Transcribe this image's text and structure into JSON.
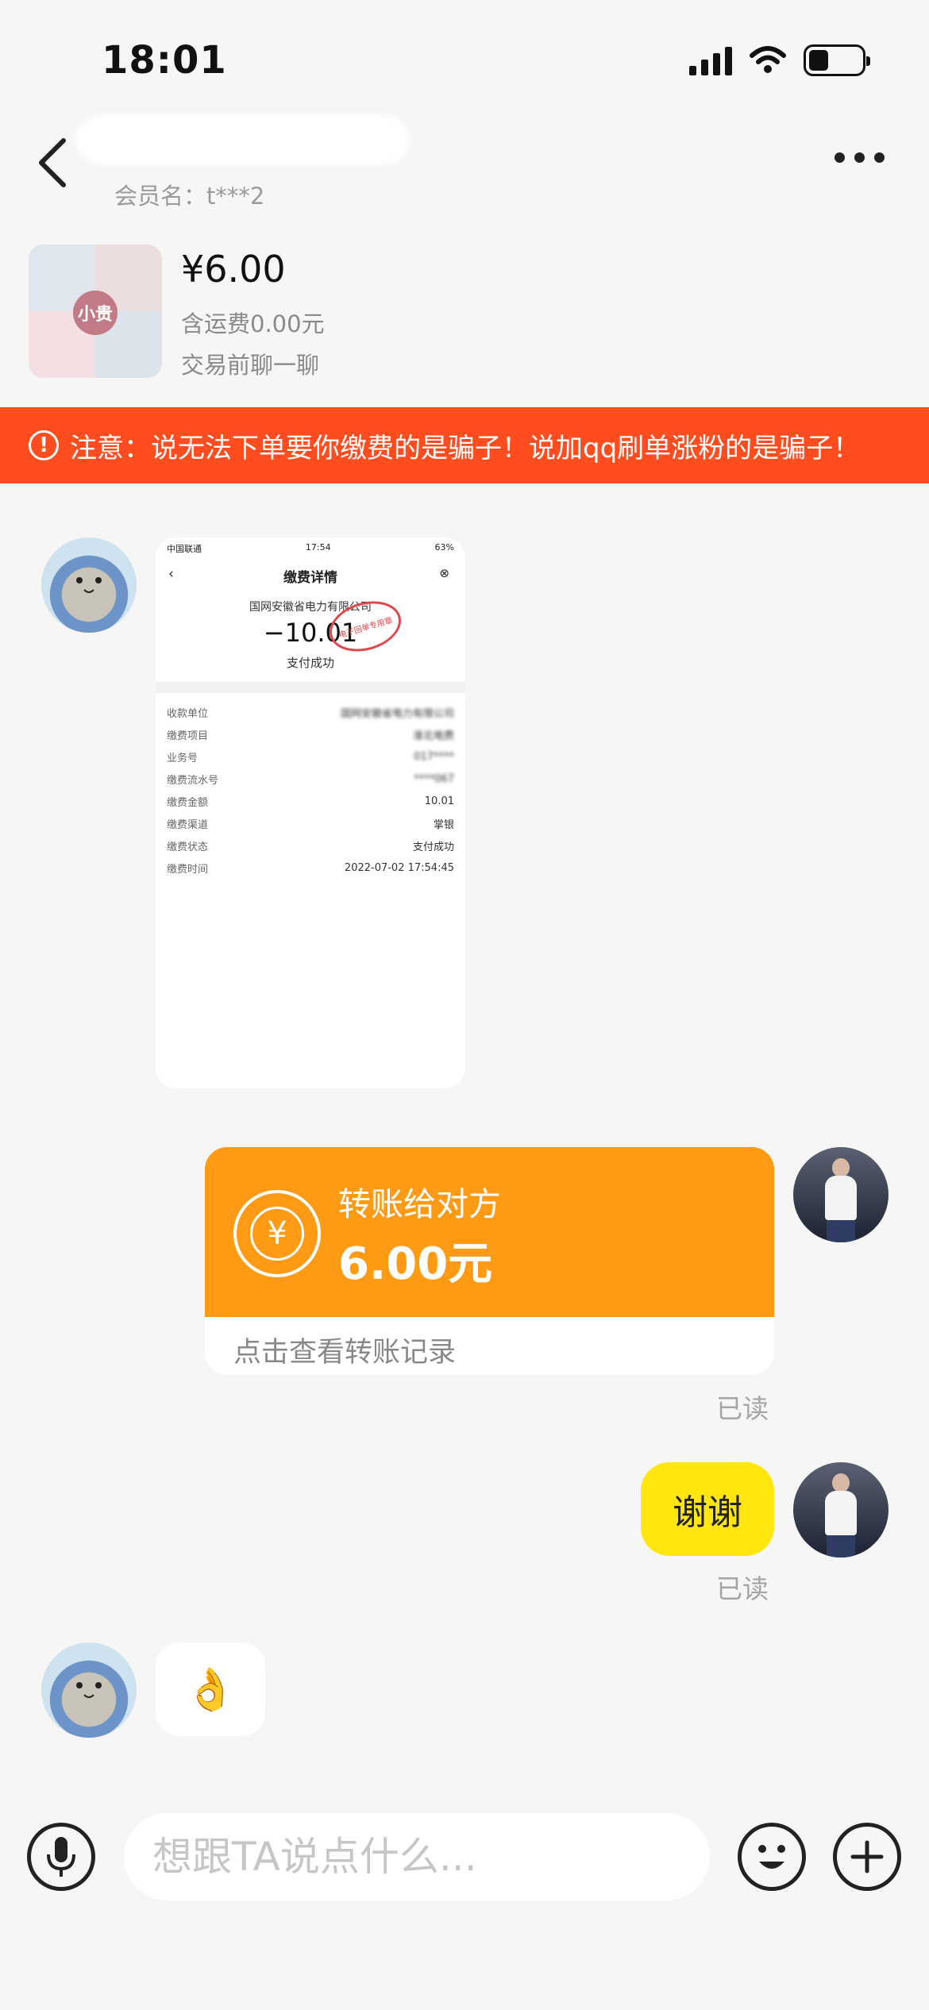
{
  "status_bar": {
    "time": "18:01"
  },
  "header": {
    "member_label": "会员名：t***2"
  },
  "product": {
    "price": "¥6.00",
    "shipping": "含运费0.00元",
    "note": "交易前聊一聊",
    "badge": "小贵"
  },
  "warning": {
    "text": "注意：说无法下单要你缴费的是骗子！说加qq刷单涨粉的是骗子！"
  },
  "read_label": "已读",
  "screenshot": {
    "carrier": "中国联通",
    "time": "17:54",
    "battery": "63%",
    "title": "缴费详情",
    "payee": "国网安徽省电力有限公司",
    "amount": "−10.01",
    "status": "支付成功",
    "stamp": "电子回单专用章",
    "rows": [
      {
        "key": "收款单位",
        "value": "国网安徽省电力有限公司"
      },
      {
        "key": "缴费项目",
        "value": "淮北电费"
      },
      {
        "key": "业务号",
        "value": "017****"
      },
      {
        "key": "缴费流水号",
        "value": "****067"
      },
      {
        "key": "缴费金额",
        "value": "10.01"
      },
      {
        "key": "缴费渠道",
        "value": "掌银"
      },
      {
        "key": "缴费状态",
        "value": "支付成功"
      },
      {
        "key": "缴费时间",
        "value": "2022-07-02 17:54:45"
      }
    ]
  },
  "transfer": {
    "label": "转账给对方",
    "amount": "6.00元",
    "link": "点击查看转账记录"
  },
  "messages": {
    "thanks": "谢谢",
    "ok_emoji": "👌"
  },
  "input": {
    "placeholder": "想跟TA说点什么..."
  }
}
